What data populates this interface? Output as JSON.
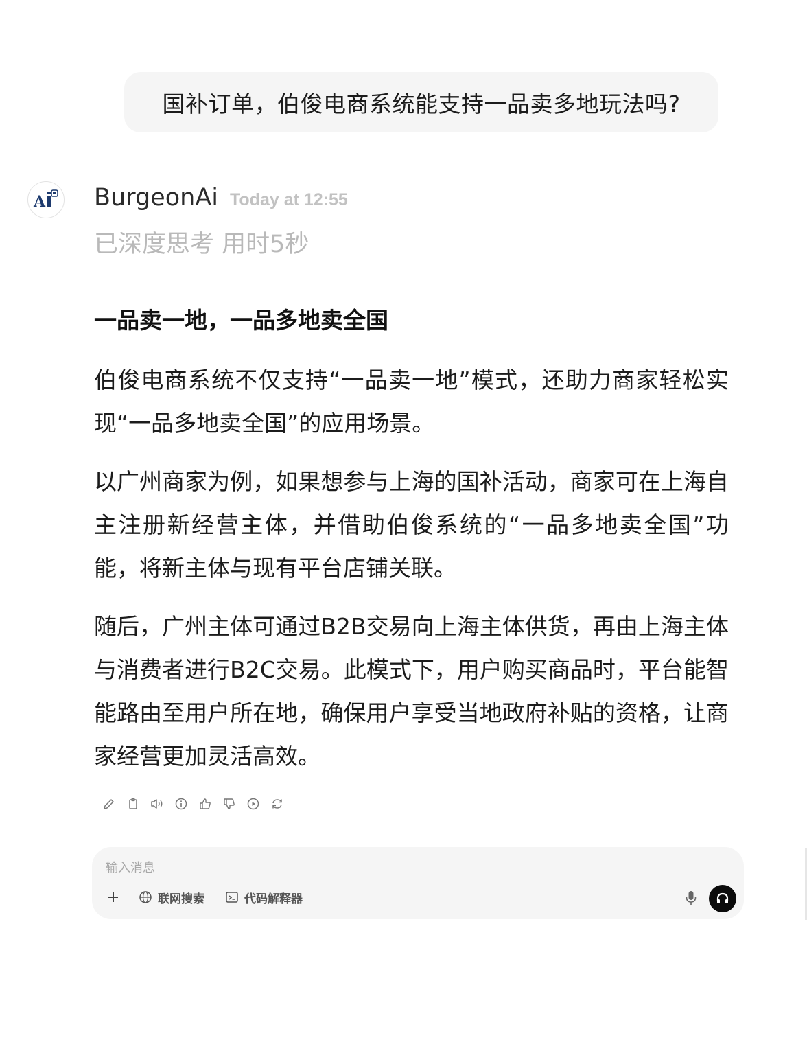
{
  "user_message": {
    "text": "国补订单，伯俊电商系统能支持一品卖多地玩法吗?"
  },
  "assistant": {
    "name": "BurgeonAi",
    "timestamp": "Today at 12:55",
    "thinking_status": "已深度思考 用时5秒",
    "heading": "一品卖一地，一品多地卖全国",
    "paragraphs": [
      "伯俊电商系统不仅支持“一品卖一地”模式，还助力商家轻松实现“一品多地卖全国”的应用场景。",
      "以广州商家为例，如果想参与上海的国补活动，商家可在上海自主注册新经营主体，并借助伯俊系统的“一品多地卖全国”功能，将新主体与现有平台店铺关联。",
      "随后，广州主体可通过B2B交易向上海主体供货，再由上海主体与消费者进行B2C交易。此模式下，用户购买商品时，平台能智能路由至用户所在地，确保用户享受当地政府补贴的资格，让商家经营更加灵活高效。"
    ],
    "actions": [
      "edit-icon",
      "copy-icon",
      "speaker-icon",
      "info-icon",
      "thumbs-up-icon",
      "thumbs-down-icon",
      "play-icon",
      "regenerate-icon"
    ]
  },
  "composer": {
    "placeholder": "输入消息",
    "tools": {
      "web_search": "联网搜索",
      "code_interpreter": "代码解释器"
    }
  },
  "colors": {
    "bubble_bg": "#f5f5f5",
    "muted_text": "#b9b9b9",
    "avatar_navy": "#1d3a6e",
    "voice_button": "#0b0b0b"
  }
}
